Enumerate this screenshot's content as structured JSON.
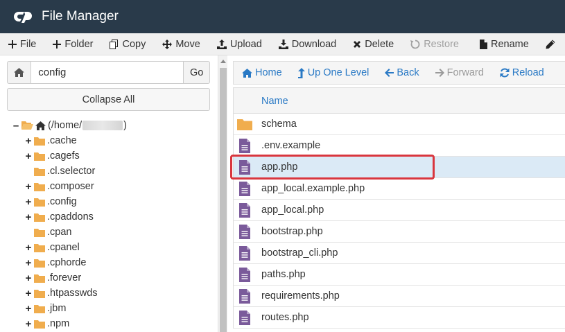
{
  "header": {
    "title": "File Manager",
    "logo_icon": "cpanel-logo-icon"
  },
  "toolbar": {
    "buttons": [
      {
        "label": "File",
        "icon": "plus-icon"
      },
      {
        "label": "Folder",
        "icon": "plus-icon"
      },
      {
        "label": "Copy",
        "icon": "copy-icon"
      },
      {
        "label": "Move",
        "icon": "move-icon"
      },
      {
        "label": "Upload",
        "icon": "upload-icon"
      },
      {
        "label": "Download",
        "icon": "download-icon"
      },
      {
        "label": "Delete",
        "icon": "close-icon"
      },
      {
        "label": "Restore",
        "icon": "restore-icon",
        "disabled": true
      },
      {
        "label": "Rename",
        "icon": "file-icon"
      },
      {
        "label": "",
        "icon": "pencil-icon"
      }
    ]
  },
  "left": {
    "search": {
      "value": "config"
    },
    "go_label": "Go",
    "collapse_label": "Collapse All",
    "tree": {
      "root_label_prefix": "(/home/",
      "root_label_suffix": ")",
      "items": [
        {
          "label": ".cache",
          "toggle": "+"
        },
        {
          "label": ".cagefs",
          "toggle": "+"
        },
        {
          "label": ".cl.selector",
          "toggle": ""
        },
        {
          "label": ".composer",
          "toggle": "+"
        },
        {
          "label": ".config",
          "toggle": "+"
        },
        {
          "label": ".cpaddons",
          "toggle": "+"
        },
        {
          "label": ".cpan",
          "toggle": ""
        },
        {
          "label": ".cpanel",
          "toggle": "+"
        },
        {
          "label": ".cphorde",
          "toggle": "+"
        },
        {
          "label": ".forever",
          "toggle": "+"
        },
        {
          "label": ".htpasswds",
          "toggle": "+"
        },
        {
          "label": ".jbm",
          "toggle": "+"
        },
        {
          "label": ".npm",
          "toggle": "+"
        }
      ]
    }
  },
  "nav": {
    "home": "Home",
    "up": "Up One Level",
    "back": "Back",
    "forward": "Forward",
    "reload": "Reload"
  },
  "files": {
    "column_name": "Name",
    "rows": [
      {
        "name": "schema",
        "type": "folder"
      },
      {
        "name": ".env.example",
        "type": "file"
      },
      {
        "name": "app.php",
        "type": "file",
        "selected": true
      },
      {
        "name": "app_local.example.php",
        "type": "file"
      },
      {
        "name": "app_local.php",
        "type": "file"
      },
      {
        "name": "bootstrap.php",
        "type": "file"
      },
      {
        "name": "bootstrap_cli.php",
        "type": "file"
      },
      {
        "name": "paths.php",
        "type": "file"
      },
      {
        "name": "requirements.php",
        "type": "file"
      },
      {
        "name": "routes.php",
        "type": "file"
      }
    ]
  },
  "colors": {
    "header_bg": "#293a4a",
    "link_blue": "#2979c5",
    "folder_orange": "#f0ad4e",
    "file_purple": "#7a5a9a",
    "selected_row": "#dbeaf6",
    "highlight_red": "#d9363e"
  }
}
